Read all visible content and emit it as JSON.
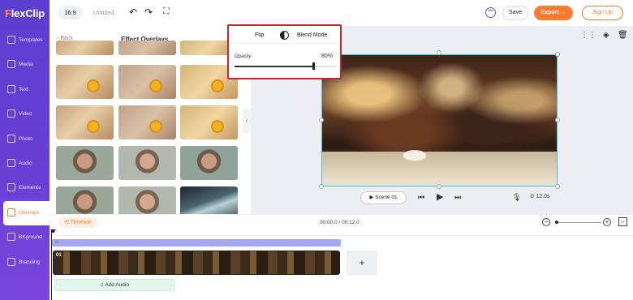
{
  "app": {
    "logo": "FlexClip",
    "logo_first": "F"
  },
  "sidebar": {
    "items": [
      {
        "label": "Templates",
        "icon": "templates-icon"
      },
      {
        "label": "Media",
        "icon": "media-icon"
      },
      {
        "label": "Text",
        "icon": "text-icon"
      },
      {
        "label": "Video",
        "icon": "video-icon"
      },
      {
        "label": "Photo",
        "icon": "photo-icon"
      },
      {
        "label": "Audio",
        "icon": "audio-icon"
      },
      {
        "label": "Elements",
        "icon": "elements-icon"
      },
      {
        "label": "Overlays",
        "icon": "overlays-icon",
        "active": true
      },
      {
        "label": "BKground",
        "icon": "background-icon"
      },
      {
        "label": "Branding",
        "icon": "branding-icon"
      }
    ]
  },
  "topbar": {
    "ratio": "16:9",
    "title": "Untitled",
    "save": "Save",
    "export": "Export →",
    "signup": "Sign Up"
  },
  "panel": {
    "back": "‹ Back",
    "title": "Effect Overlays"
  },
  "popup": {
    "flip": "Flip",
    "blend": "Blend Mode",
    "opacity_label": "Opacity",
    "opacity_value": "80%",
    "opacity": 0.8
  },
  "playback": {
    "scene": "▶ Scene 01",
    "duration": "⏲ 12.0s"
  },
  "timeline": {
    "label": "Timeline",
    "timecode": "00:00.0 / 00:12.0",
    "overlay_tag": "⊡",
    "clip_number": "01",
    "add_audio": "♫  Add Audio",
    "add_clip": "+"
  },
  "colors": {
    "accent": "#ff7a2d",
    "brand": "#5a3fd0",
    "highlight": "#c1272d",
    "selection": "#3ec2e0"
  }
}
